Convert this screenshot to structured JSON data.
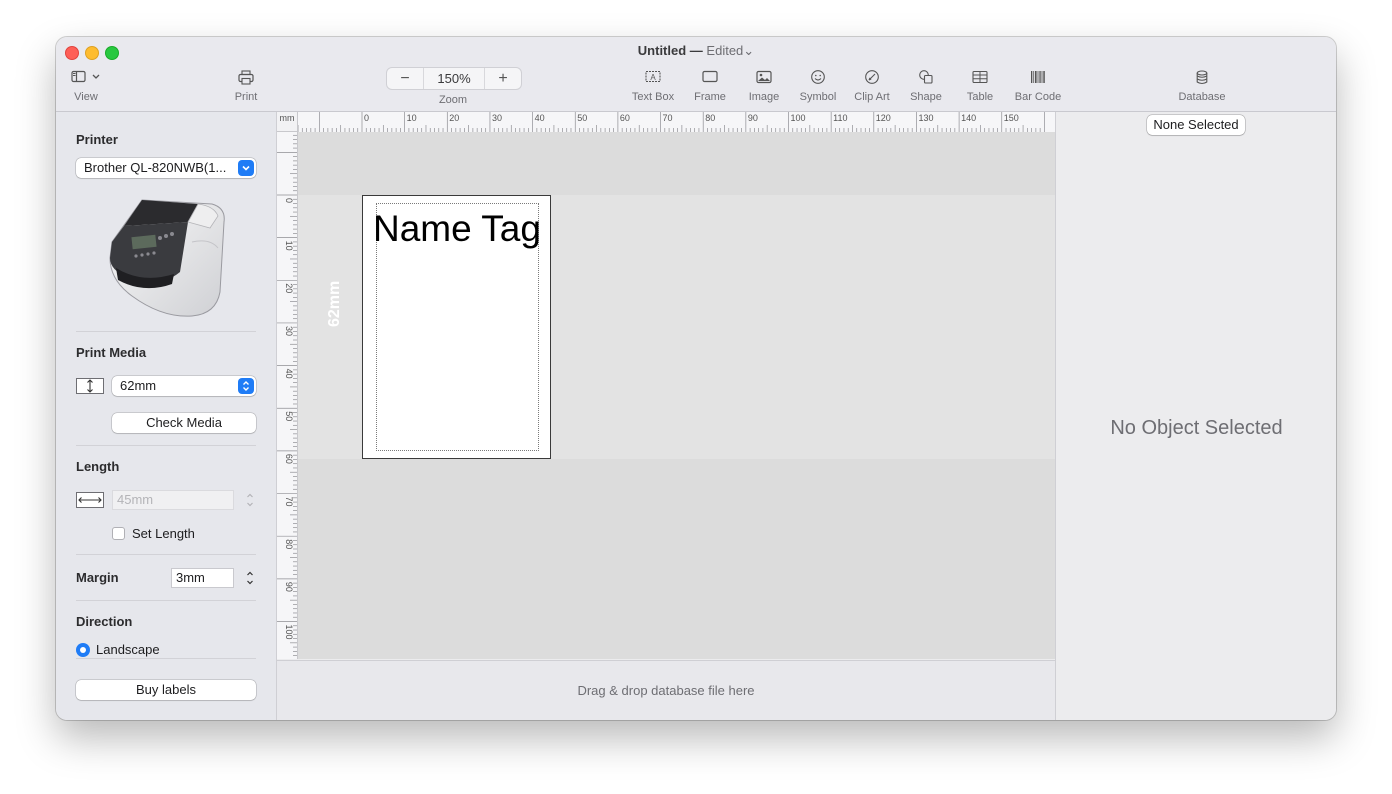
{
  "window": {
    "title": "Untitled",
    "title_separator": "—",
    "status": "Edited"
  },
  "toolbar": {
    "view_label": "View",
    "print_label": "Print",
    "zoom": {
      "label": "Zoom",
      "value": "150%",
      "minus": "−",
      "plus": "+"
    },
    "items": [
      {
        "label": "Text Box",
        "icon": "text-box-icon"
      },
      {
        "label": "Frame",
        "icon": "frame-icon"
      },
      {
        "label": "Image",
        "icon": "image-icon"
      },
      {
        "label": "Symbol",
        "icon": "symbol-icon"
      },
      {
        "label": "Clip Art",
        "icon": "clip-art-icon"
      },
      {
        "label": "Shape",
        "icon": "shape-icon"
      },
      {
        "label": "Table",
        "icon": "table-icon"
      },
      {
        "label": "Bar Code",
        "icon": "barcode-icon"
      }
    ],
    "database_label": "Database"
  },
  "sidebar": {
    "printer_title": "Printer",
    "printer_value": "Brother QL-820NWB(1...",
    "print_media_title": "Print Media",
    "media_value": "62mm",
    "check_media_label": "Check Media",
    "length_title": "Length",
    "length_value": "45mm",
    "set_length_label": "Set Length",
    "set_length_checked": false,
    "margin_title": "Margin",
    "margin_value": "3mm",
    "direction_title": "Direction",
    "landscape_label": "Landscape",
    "buy_labels_label": "Buy labels"
  },
  "canvas": {
    "ruler_unit": "mm",
    "top_ticks": [
      "0",
      "10",
      "20",
      "30",
      "40",
      "50",
      "60",
      "70",
      "80",
      "90",
      "100",
      "110",
      "120",
      "130",
      "140",
      "150"
    ],
    "left_ticks": [
      "0",
      "10",
      "20",
      "30",
      "40",
      "50",
      "60",
      "70",
      "80",
      "90",
      "100"
    ],
    "label_text": "Name Tag",
    "height_label": "62mm",
    "drop_hint": "Drag & drop database file here"
  },
  "inspector": {
    "selection_label": "None Selected",
    "empty_message": "No Object Selected"
  },
  "colors": {
    "accent": "#1f7cf6",
    "close": "#fe5f57",
    "minimize": "#febc2e",
    "maximize": "#28c840"
  }
}
